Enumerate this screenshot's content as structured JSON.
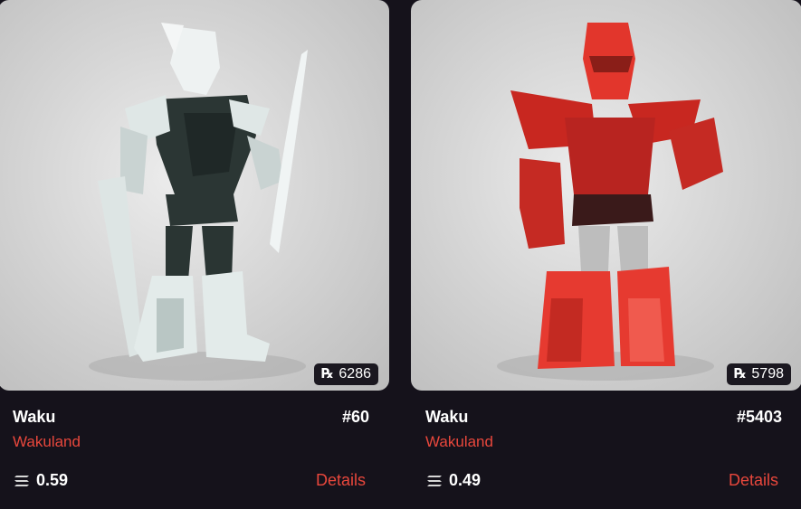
{
  "cards": [
    {
      "title": "Waku",
      "number": "#60",
      "collection": "Wakuland",
      "rank": "6286",
      "price": "0.59",
      "details": "Details",
      "theme": "white",
      "colors": {
        "armor": "#e8eeee",
        "armor_shade": "#9fb0ae",
        "dark": "#2a3533"
      }
    },
    {
      "title": "Waku",
      "number": "#5403",
      "collection": "Wakuland",
      "rank": "5798",
      "price": "0.49",
      "details": "Details",
      "theme": "red",
      "colors": {
        "armor": "#e2362c",
        "armor_shade": "#a41e1a",
        "dark": "#3a1a1a"
      }
    }
  ],
  "icons": {
    "rank": "rank-icon",
    "currency": "sol-icon"
  },
  "accent": "#e8473c"
}
